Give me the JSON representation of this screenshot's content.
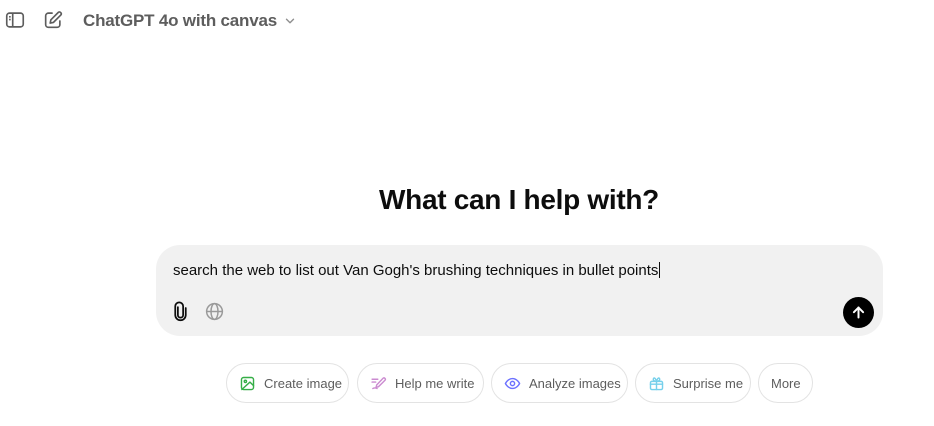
{
  "header": {
    "model_title": "ChatGPT 4o with canvas",
    "icons": [
      "sidebar-toggle-icon",
      "new-chat-icon",
      "chevron-down-icon"
    ]
  },
  "main": {
    "headline": "What can I help with?"
  },
  "composer": {
    "input_value": "search the web to list out Van Gogh's brushing techniques in bullet points",
    "icons": [
      "paperclip-icon",
      "globe-icon",
      "arrow-up-icon"
    ]
  },
  "suggestions": [
    {
      "label": "Create image",
      "icon": "image-icon",
      "color": "#35ae47"
    },
    {
      "label": "Help me write",
      "icon": "pen-icon",
      "color": "#cb8bd0"
    },
    {
      "label": "Analyze images",
      "icon": "eye-icon",
      "color": "#6c71ff"
    },
    {
      "label": "Surprise me",
      "icon": "gift-icon",
      "color": "#76d0eb"
    },
    {
      "label": "More",
      "icon": "",
      "color": ""
    }
  ],
  "colors": {
    "composer_bg": "#f1f1f1",
    "send_bg": "#000000",
    "muted_text": "#5d5d5d"
  }
}
